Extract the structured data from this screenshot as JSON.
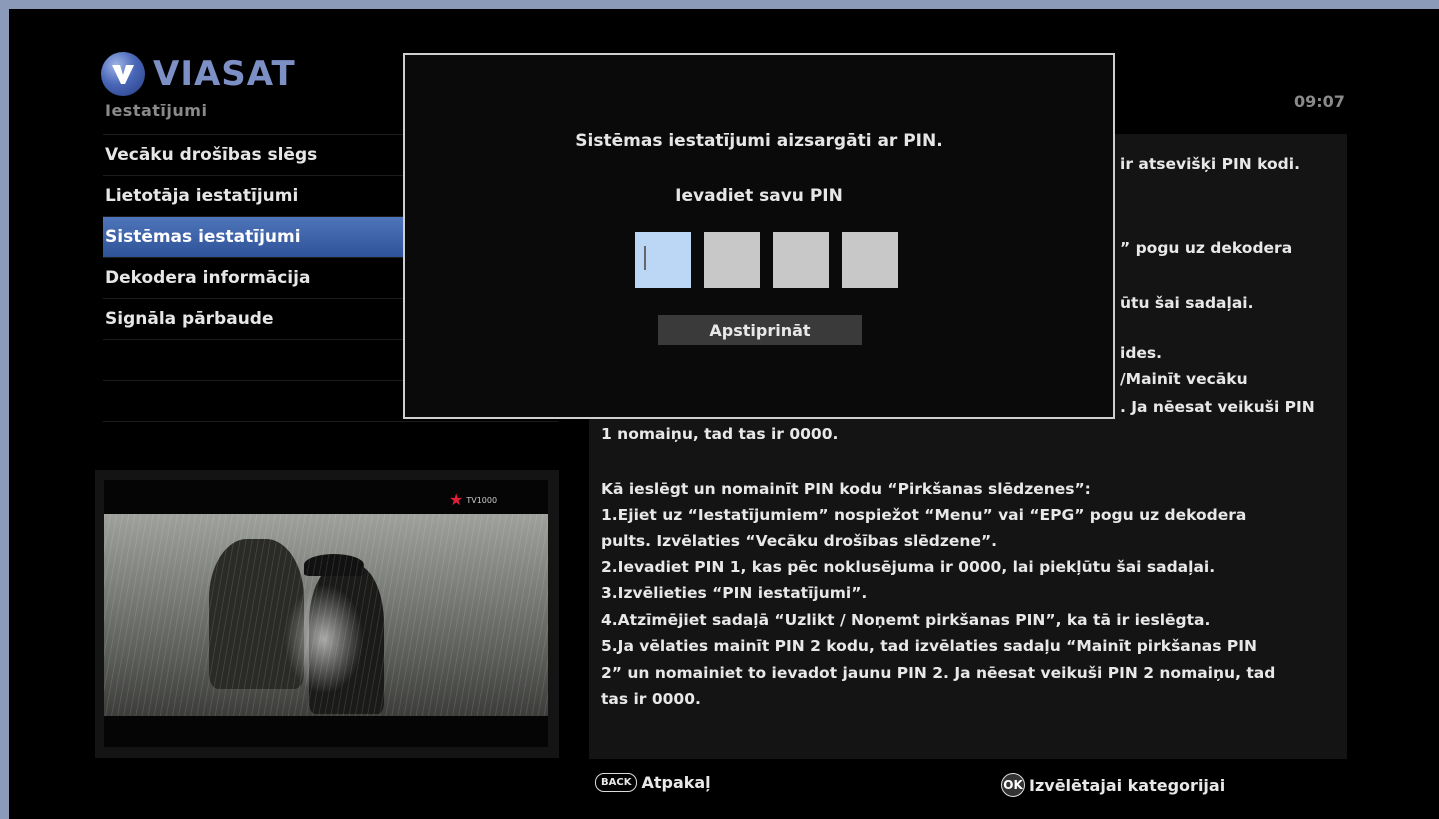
{
  "header": {
    "logo_text": "VIASAT",
    "section_title": "Iestatījumi",
    "clock": "09:07"
  },
  "menu": {
    "items": [
      {
        "label": "Vecāku drošības slēgs"
      },
      {
        "label": "Lietotāja iestatījumi"
      },
      {
        "label": "Sistēmas iestatījumi",
        "selected": true
      },
      {
        "label": "Dekodera informācija"
      },
      {
        "label": "Signāla pārbaude"
      }
    ]
  },
  "preview": {
    "channel_logo_text": "TV1000"
  },
  "info": {
    "visible_fragments": [
      "ir atsevišķi PIN kodi.",
      "” pogu uz dekodera",
      "ūtu šai sadaļai.",
      "ides.",
      "/Mainīt vecāku",
      ". Ja nēesat veikuši PIN"
    ],
    "lines": [
      "1 nomaiņu, tad tas ir 0000.",
      "",
      "Kā ieslēgt un nomainīt PIN kodu “Pirkšanas slēdzenes”:",
      "1.Ejiet uz “Iestatījumiem” nospiežot “Menu” vai “EPG” pogu uz dekodera",
      "pults. Izvēlaties “Vecāku drošības slēdzene”.",
      "2.Ievadiet PIN 1, kas pēc noklusējuma ir 0000, lai piekļūtu šai sadaļai.",
      "3.Izvēlieties “PIN iestatījumi”.",
      "4.Atzīmējiet sadaļā “Uzlikt / Noņemt pirkšanas PIN”, ka tā ir ieslēgta.",
      "5.Ja vēlaties mainīt PIN 2 kodu, tad izvēlaties sadaļu “Mainīt pirkšanas PIN",
      "2” un nomainiet to ievadot jaunu PIN 2. Ja nēesat veikuši PIN 2 nomaiņu, tad",
      "tas ir 0000."
    ]
  },
  "footer": {
    "back_key": "BACK",
    "back_label": "Atpakaļ",
    "ok_key": "OK",
    "ok_label": "Izvēlētajai kategorijai"
  },
  "dialog": {
    "message": "Sistēmas iestatījumi aizsargāti ar PIN.",
    "prompt": "Ievadiet savu PIN",
    "pin_values": [
      "",
      "",
      "",
      ""
    ],
    "confirm_label": "Apstiprināt"
  },
  "colors": {
    "selection": "#3f63a8",
    "logo": "#7d90c6",
    "active_pin": "#bcd7f5"
  }
}
